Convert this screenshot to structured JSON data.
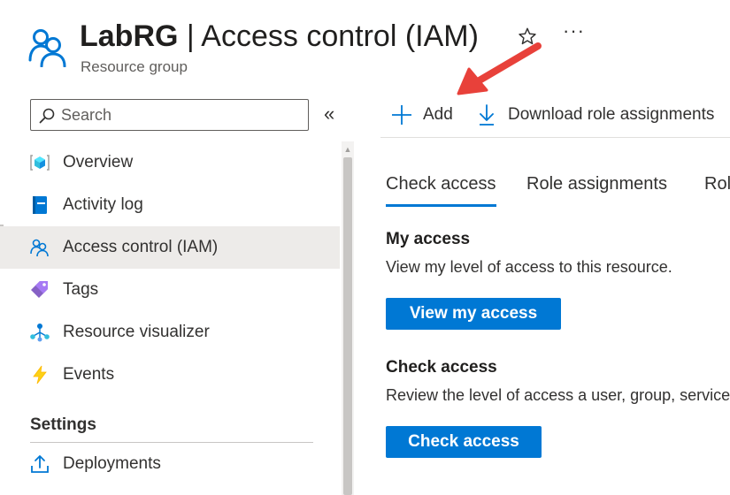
{
  "header": {
    "title_name": "LabRG",
    "title_rest": " | Access control (IAM)",
    "subtitle": "Resource group",
    "more_label": "···"
  },
  "sidebar": {
    "search": {
      "placeholder": "Search",
      "value": ""
    },
    "collapse_label": "«",
    "items": [
      {
        "label": "Overview",
        "icon": "overview-cube-icon"
      },
      {
        "label": "Activity log",
        "icon": "activity-log-icon"
      },
      {
        "label": "Access control (IAM)",
        "icon": "people-icon",
        "active": true
      },
      {
        "label": "Tags",
        "icon": "tag-icon"
      },
      {
        "label": "Resource visualizer",
        "icon": "resource-visualizer-icon"
      },
      {
        "label": "Events",
        "icon": "lightning-icon"
      }
    ],
    "settings_section": "Settings",
    "settings_items": [
      {
        "label": "Deployments",
        "icon": "deployments-upload-icon"
      }
    ]
  },
  "command_bar": {
    "add_label": "Add",
    "download_label": "Download role assignments"
  },
  "tabs": [
    {
      "label": "Check access",
      "active": true
    },
    {
      "label": "Role assignments",
      "active": false
    },
    {
      "label": "Roles",
      "active": false
    }
  ],
  "my_access": {
    "heading": "My access",
    "description": "View my level of access to this resource.",
    "button_label": "View my access"
  },
  "check_access": {
    "heading": "Check access",
    "description": "Review the level of access a user, group, service principal, or managed identity has to this resource.",
    "button_label": "Check access"
  },
  "colors": {
    "accent": "#0078d4",
    "annotation_arrow": "#e8413a",
    "active_nav_bg": "#edebe9"
  }
}
